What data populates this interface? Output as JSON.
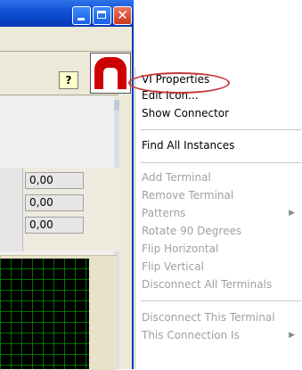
{
  "window": {
    "buttons": {
      "minimize_icon": "minimize-icon",
      "maximize_icon": "maximize-icon",
      "close_icon": "close-icon",
      "close_glyph": "✕"
    }
  },
  "toolbar": {
    "help_glyph": "?",
    "vi_icon": "vi-icon"
  },
  "panel": {
    "numeric_values": [
      "0,00",
      "0,00",
      "0,00"
    ]
  },
  "context_menu": {
    "items": [
      {
        "label": "VI Properties",
        "enabled": true
      },
      {
        "label": "Edit Icon...",
        "enabled": true
      },
      {
        "label": "Show Connector",
        "enabled": true
      },
      {
        "label": "Find All Instances",
        "enabled": true
      },
      {
        "label": "Add Terminal",
        "enabled": false
      },
      {
        "label": "Remove Terminal",
        "enabled": false
      },
      {
        "label": "Patterns",
        "enabled": false,
        "submenu": true
      },
      {
        "label": "Rotate 90 Degrees",
        "enabled": false
      },
      {
        "label": "Flip Horizontal",
        "enabled": false
      },
      {
        "label": "Flip Vertical",
        "enabled": false
      },
      {
        "label": "Disconnect All Terminals",
        "enabled": false
      },
      {
        "label": "Disconnect This Terminal",
        "enabled": false
      },
      {
        "label": "This Connection Is",
        "enabled": false,
        "submenu": true
      }
    ],
    "submenu_arrow_glyph": "▶"
  },
  "colors": {
    "titlebar_blue": "#0a43c8",
    "close_red": "#c9391f",
    "highlight_ellipse": "#c8383c",
    "disabled_text": "#a0a0a0"
  }
}
